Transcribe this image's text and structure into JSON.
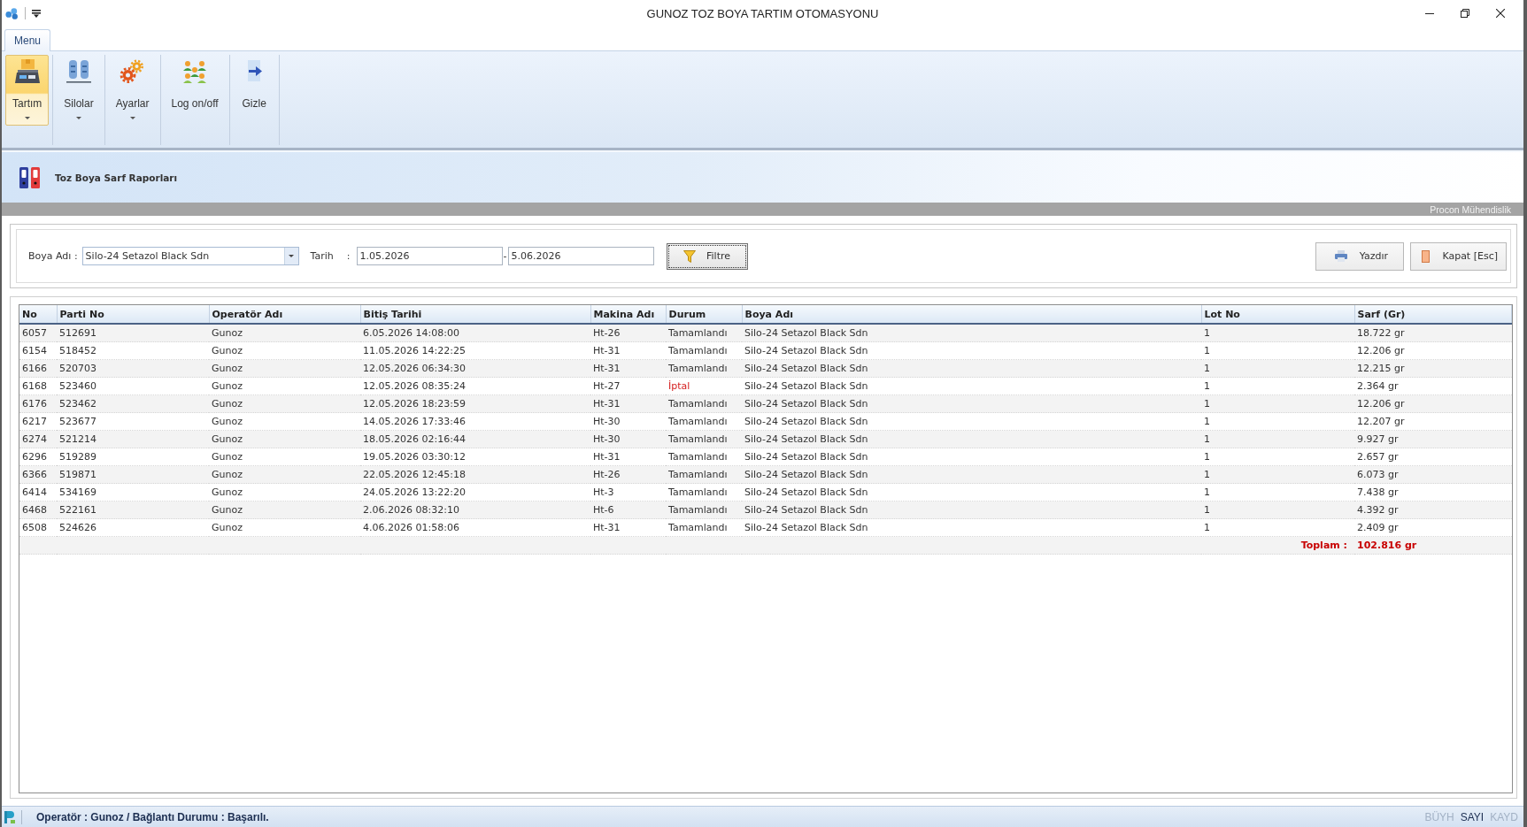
{
  "window": {
    "title": "GUNOZ TOZ BOYA TARTIM OTOMASYONU"
  },
  "ribbon": {
    "tabs": [
      {
        "label": "Menu",
        "selected": true
      }
    ],
    "buttons": [
      {
        "label": "Tartım",
        "selected": true,
        "dropdown": true
      },
      {
        "label": "Silolar",
        "selected": false,
        "dropdown": true
      },
      {
        "label": "Ayarlar",
        "selected": false,
        "dropdown": true
      },
      {
        "label": "Log on/off",
        "selected": false,
        "dropdown": false
      },
      {
        "label": "Gizle",
        "selected": false,
        "dropdown": false
      }
    ]
  },
  "report_header": {
    "title": "Toz Boya Sarf Raporları",
    "company": "Procon Mühendislik"
  },
  "filter": {
    "paint_label": "Boya Adı :",
    "paint_value": "Silo-24 Setazol Black Sdn",
    "date_label": "Tarih",
    "date_colon": ":",
    "date_from": "1.05.2026",
    "date_separator": "-",
    "date_to": "5.06.2026",
    "filter_button": "Filtre",
    "print_button": "Yazdır",
    "close_button": "Kapat [Esc]"
  },
  "table": {
    "columns": [
      "No",
      "Parti No",
      "Operatör Adı",
      "Bitiş Tarihi",
      "Makina Adı",
      "Durum",
      "Boya Adı",
      "Lot No",
      "Sarf (Gr)"
    ],
    "rows": [
      {
        "cells": [
          "6057",
          "512691",
          "Gunoz",
          "6.05.2026 14:08:00",
          "Ht-26",
          "Tamamlandı",
          "Silo-24 Setazol Black Sdn",
          "1",
          "18.722 gr"
        ],
        "cancelled": false
      },
      {
        "cells": [
          "6154",
          "518452",
          "Gunoz",
          "11.05.2026 14:22:25",
          "Ht-31",
          "Tamamlandı",
          "Silo-24 Setazol Black Sdn",
          "1",
          "12.206 gr"
        ],
        "cancelled": false
      },
      {
        "cells": [
          "6166",
          "520703",
          "Gunoz",
          "12.05.2026 06:34:30",
          "Ht-31",
          "Tamamlandı",
          "Silo-24 Setazol Black Sdn",
          "1",
          "12.215 gr"
        ],
        "cancelled": false
      },
      {
        "cells": [
          "6168",
          "523460",
          "Gunoz",
          "12.05.2026 08:35:24",
          "Ht-27",
          "İptal",
          "Silo-24 Setazol Black Sdn",
          "1",
          "2.364 gr"
        ],
        "cancelled": true
      },
      {
        "cells": [
          "6176",
          "523462",
          "Gunoz",
          "12.05.2026 18:23:59",
          "Ht-31",
          "Tamamlandı",
          "Silo-24 Setazol Black Sdn",
          "1",
          "12.206 gr"
        ],
        "cancelled": false
      },
      {
        "cells": [
          "6217",
          "523677",
          "Gunoz",
          "14.05.2026 17:33:46",
          "Ht-30",
          "Tamamlandı",
          "Silo-24 Setazol Black Sdn",
          "1",
          "12.207 gr"
        ],
        "cancelled": false
      },
      {
        "cells": [
          "6274",
          "521214",
          "Gunoz",
          "18.05.2026 02:16:44",
          "Ht-30",
          "Tamamlandı",
          "Silo-24 Setazol Black Sdn",
          "1",
          "9.927 gr"
        ],
        "cancelled": false
      },
      {
        "cells": [
          "6296",
          "519289",
          "Gunoz",
          "19.05.2026 03:30:12",
          "Ht-31",
          "Tamamlandı",
          "Silo-24 Setazol Black Sdn",
          "1",
          "2.657 gr"
        ],
        "cancelled": false
      },
      {
        "cells": [
          "6366",
          "519871",
          "Gunoz",
          "22.05.2026 12:45:18",
          "Ht-26",
          "Tamamlandı",
          "Silo-24 Setazol Black Sdn",
          "1",
          "6.073 gr"
        ],
        "cancelled": false
      },
      {
        "cells": [
          "6414",
          "534169",
          "Gunoz",
          "24.05.2026 13:22:20",
          "Ht-3",
          "Tamamlandı",
          "Silo-24 Setazol Black Sdn",
          "1",
          "7.438 gr"
        ],
        "cancelled": false
      },
      {
        "cells": [
          "6468",
          "522161",
          "Gunoz",
          "2.06.2026 08:32:10",
          "Ht-6",
          "Tamamlandı",
          "Silo-24 Setazol Black Sdn",
          "1",
          "4.392 gr"
        ],
        "cancelled": false
      },
      {
        "cells": [
          "6508",
          "524626",
          "Gunoz",
          "4.06.2026 01:58:06",
          "Ht-31",
          "Tamamlandı",
          "Silo-24 Setazol Black Sdn",
          "1",
          "2.409 gr"
        ],
        "cancelled": false
      }
    ],
    "total_label": "Toplam :",
    "total_value": "102.816 gr"
  },
  "status_bar": {
    "text": "Operatör : Gunoz / Bağlantı Durumu : Başarılı.",
    "indicators": [
      {
        "label": "BÜYH",
        "on": false
      },
      {
        "label": "SAYI",
        "on": true
      },
      {
        "label": "KAYD",
        "on": false
      }
    ]
  }
}
